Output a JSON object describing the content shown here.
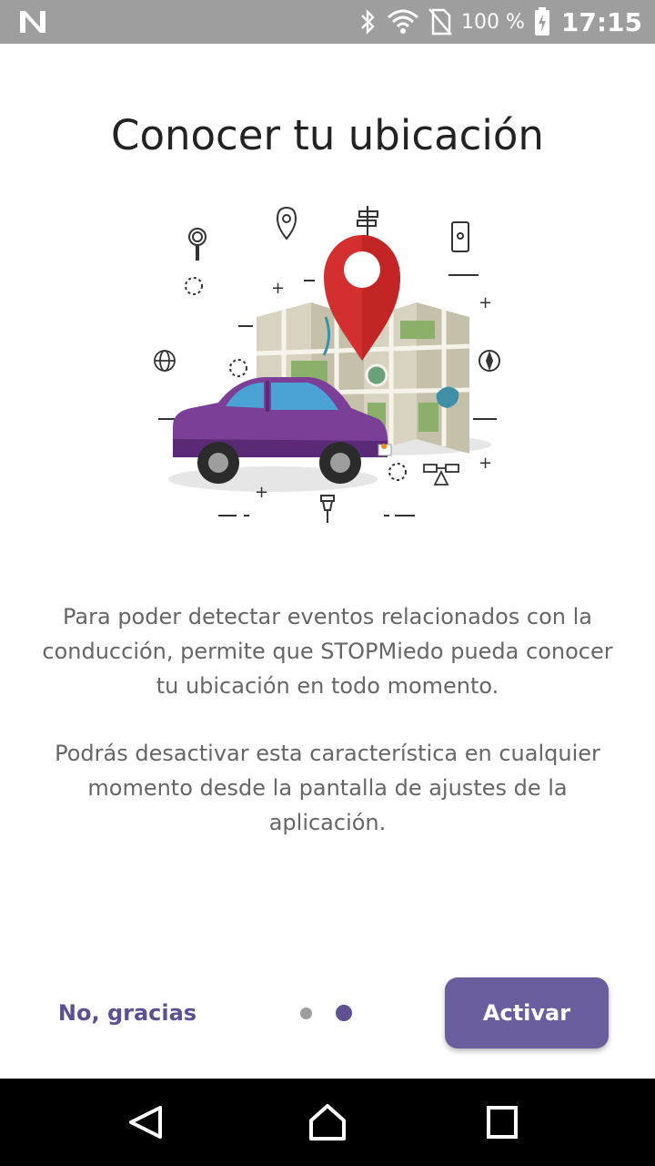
{
  "status_bar": {
    "battery_percent": "100 %",
    "time": "17:15",
    "icons": [
      "n-logo-icon",
      "bluetooth-icon",
      "wifi-icon",
      "no-sim-icon",
      "battery-charging-icon"
    ]
  },
  "screen": {
    "title": "Conocer tu ubicación",
    "paragraph1": "Para poder detectar eventos relacionados con la conducción, permite que STOPMiedo pueda conocer tu ubicación en todo momento.",
    "paragraph2": "Podrás desactivar esta característica en cualquier momento desde la pantalla de ajustes de la aplicación."
  },
  "actions": {
    "decline_label": "No, gracias",
    "accept_label": "Activar"
  },
  "pager": {
    "total_pages": 2,
    "current_page": 2
  },
  "colors": {
    "accent": "#6b5e9f",
    "accent_text": "#5f5191",
    "pin_red": "#d32f2f",
    "car_purple": "#7b3f98",
    "status_bar": "#9e9e9e",
    "nav_bar": "#000000"
  },
  "nav_bar": {
    "icons": [
      "back-icon",
      "home-icon",
      "recents-icon"
    ]
  }
}
